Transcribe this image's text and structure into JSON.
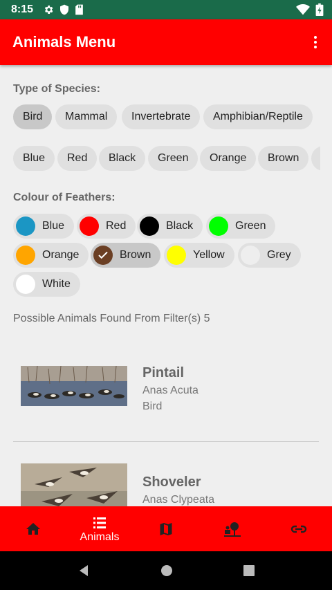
{
  "status_bar": {
    "time": "8:15"
  },
  "app_bar": {
    "title": "Animals Menu"
  },
  "species": {
    "title": "Type of Species:",
    "chips": [
      {
        "label": "Bird",
        "selected": true
      },
      {
        "label": "Mammal",
        "selected": false
      },
      {
        "label": "Invertebrate",
        "selected": false
      },
      {
        "label": "Amphibian/Reptile",
        "selected": false
      }
    ]
  },
  "colours_row": {
    "chips": [
      "Blue",
      "Red",
      "Black",
      "Green",
      "Orange",
      "Brown"
    ]
  },
  "feathers": {
    "title": "Colour of Feathers:",
    "chips": [
      {
        "label": "Blue",
        "color": "#1b96c4",
        "selected": false
      },
      {
        "label": "Red",
        "color": "#ff0000",
        "selected": false
      },
      {
        "label": "Black",
        "color": "#000000",
        "selected": false
      },
      {
        "label": "Green",
        "color": "#00ff00",
        "selected": false
      },
      {
        "label": "Orange",
        "color": "#ffa500",
        "selected": false
      },
      {
        "label": "Brown",
        "color": "#6b3f24",
        "selected": true
      },
      {
        "label": "Yellow",
        "color": "#ffff00",
        "selected": false
      },
      {
        "label": "Grey",
        "color": "#eeeeee",
        "selected": false
      },
      {
        "label": "White",
        "color": "#ffffff",
        "selected": false
      }
    ]
  },
  "results": {
    "text": "Possible Animals Found From Filter(s) 5"
  },
  "animals": [
    {
      "name": "Pintail",
      "scientific": "Anas Acuta",
      "type": "Bird"
    },
    {
      "name": "Shoveler",
      "scientific": "Anas Clypeata",
      "type": ""
    }
  ],
  "bottom_nav": {
    "items": [
      {
        "label": "",
        "icon": "home-icon"
      },
      {
        "label": "Animals",
        "icon": "list-icon",
        "active": true
      },
      {
        "label": "",
        "icon": "map-icon"
      },
      {
        "label": "",
        "icon": "person-tree-icon"
      },
      {
        "label": "",
        "icon": "link-icon"
      }
    ]
  }
}
